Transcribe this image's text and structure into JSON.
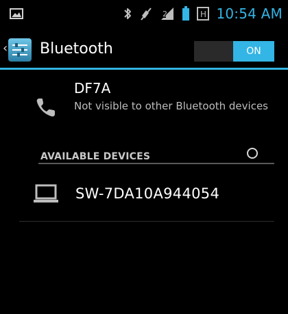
{
  "status_bar": {
    "time": "10:54 AM",
    "icons": [
      "image-notification-icon",
      "bluetooth-icon",
      "mute-icon",
      "signal-icon",
      "battery-icon",
      "h-notification-icon"
    ],
    "h_letter": "H",
    "accent_color": "#33b5e5"
  },
  "action_bar": {
    "title": "Bluetooth",
    "up_icon": "chevron-left-icon",
    "app_icon": "settings-app-icon",
    "toggle_label": "ON",
    "toggle_state": "on"
  },
  "this_device": {
    "icon": "phone-icon",
    "name": "DF7A",
    "status": "Not visible to other Bluetooth devices"
  },
  "available_devices": {
    "header": "AVAILABLE DEVICES",
    "spinner_icon": "progress-spinner-icon",
    "items": [
      {
        "icon": "laptop-icon",
        "name": "SW-7DA10A944054"
      }
    ]
  },
  "colors": {
    "background": "#000000",
    "accent": "#33b5e5",
    "secondary_text": "#bdbdbd"
  }
}
